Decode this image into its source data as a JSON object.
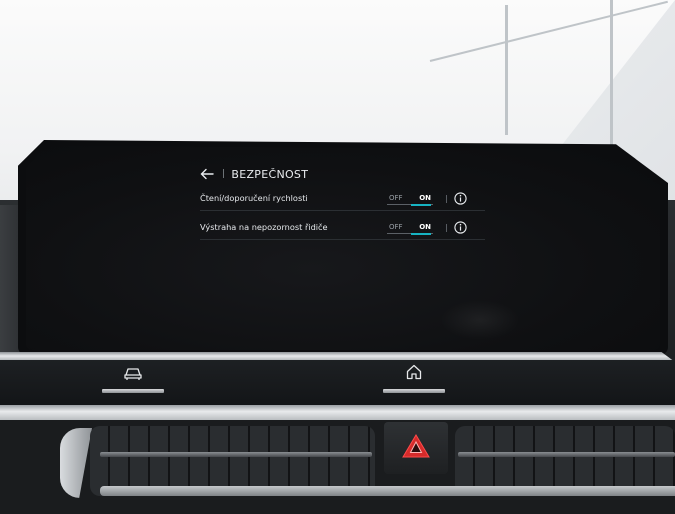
{
  "screen": {
    "header": {
      "back_icon": "back-arrow-icon",
      "separator": "|",
      "title": "BEZPEČNOST"
    },
    "settings": [
      {
        "label": "Čtení/doporučení rychlosti",
        "toggle": {
          "off_label": "OFF",
          "on_label": "ON",
          "state": "on"
        },
        "separator": "|",
        "info_icon": "info-icon"
      },
      {
        "label": "Výstraha na nepozornost řidiče",
        "toggle": {
          "off_label": "OFF",
          "on_label": "ON",
          "state": "on"
        },
        "separator": "|",
        "info_icon": "info-icon"
      }
    ],
    "accent_color": "#17b3c2"
  },
  "hardware_buttons": [
    {
      "name": "car-icon"
    },
    {
      "name": "home-icon"
    },
    {
      "name": "hazard-warning-icon"
    }
  ]
}
